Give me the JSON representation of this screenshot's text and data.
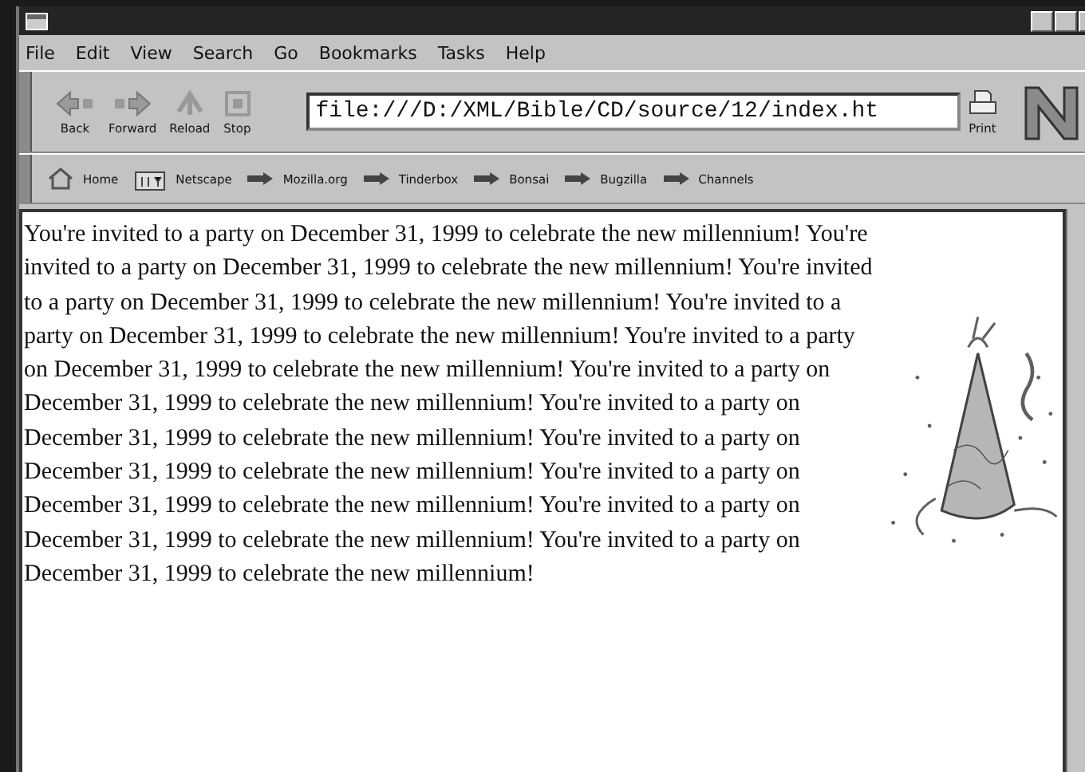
{
  "menu": [
    "File",
    "Edit",
    "View",
    "Search",
    "Go",
    "Bookmarks",
    "Tasks",
    "Help"
  ],
  "navigation": [
    {
      "kind": "back",
      "label": "Back"
    },
    {
      "kind": "forward",
      "label": "Forward"
    },
    {
      "kind": "reload",
      "label": "Reload"
    },
    {
      "kind": "stop",
      "label": "Stop"
    }
  ],
  "address": {
    "value": "file:///D:/XML/Bible/CD/source/12/index.ht"
  },
  "print": {
    "label": "Print"
  },
  "personal_toolbar": [
    {
      "kind": "home",
      "label": "Home"
    },
    {
      "kind": "netscape",
      "label": "Netscape"
    },
    {
      "kind": "bookmark",
      "label": "Mozilla.org"
    },
    {
      "kind": "bookmark",
      "label": "Tinderbox"
    },
    {
      "kind": "bookmark",
      "label": "Bonsai"
    },
    {
      "kind": "bookmark",
      "label": "Bugzilla"
    },
    {
      "kind": "bookmark",
      "label": "Channels"
    }
  ],
  "content": {
    "text": "You're invited to a party on December 31, 1999 to celebrate the new millennium! You're invited to a party on December 31, 1999 to celebrate the new millennium! You're invited to a party on December 31, 1999 to celebrate the new millennium! You're invited to a party on December 31, 1999 to celebrate the new millennium! You're invited to a party on December 31, 1999 to celebrate the new millennium! You're invited to a party on December 31, 1999 to celebrate the new millennium! You're invited to a party on December 31, 1999 to celebrate the new millennium! You're invited to a party on December 31, 1999 to celebrate the new millennium! You're invited to a party on December 31, 1999 to celebrate the new millennium! You're invited to a party on December 31, 1999 to celebrate the new millennium! You're invited to a party on December 31, 1999 to celebrate the new millennium!"
  }
}
